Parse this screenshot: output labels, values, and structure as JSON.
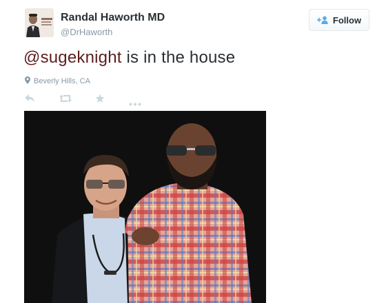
{
  "user": {
    "display_name": "Randal Haworth MD",
    "handle": "@DrHaworth",
    "avatar_icon": "doctor-portrait"
  },
  "follow_button": {
    "label": "Follow",
    "icon": "add-user-icon",
    "accent": "#55acee"
  },
  "tweet": {
    "mention": "@sugeknight",
    "text": " is in the house",
    "location": "Beverly Hills, CA",
    "mention_color": "#5e1d1d"
  },
  "actions": [
    {
      "name": "reply",
      "icon": "reply-icon"
    },
    {
      "name": "retweet",
      "icon": "retweet-icon"
    },
    {
      "name": "favorite",
      "icon": "star-icon"
    },
    {
      "name": "more",
      "icon": "more-icon"
    }
  ],
  "media": {
    "description_icon": "photo"
  }
}
